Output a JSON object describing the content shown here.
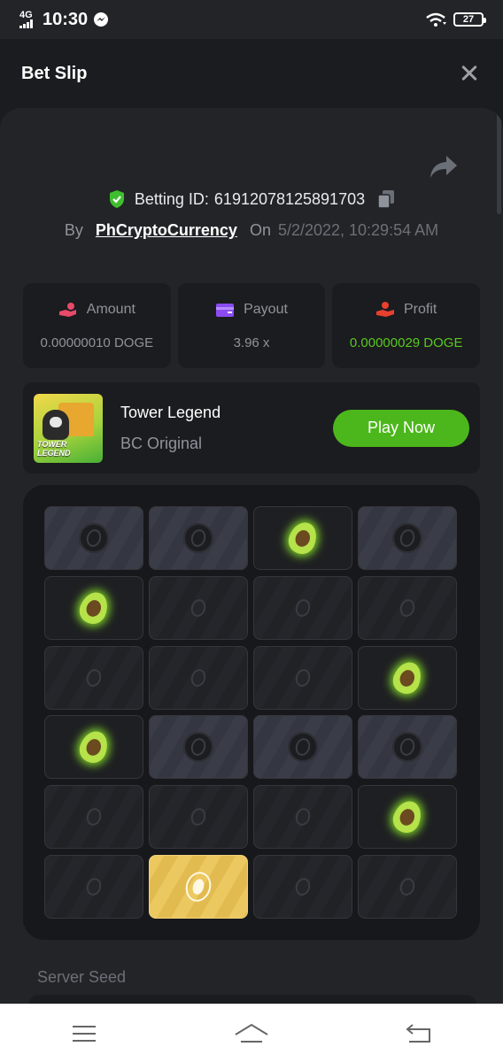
{
  "status_bar": {
    "network": "4G",
    "time": "10:30",
    "battery": "27"
  },
  "header": {
    "title": "Bet Slip"
  },
  "bet": {
    "betting_id_label": "Betting ID:",
    "betting_id": "61912078125891703",
    "by_label": "By",
    "username": "PhCryptoCurrency",
    "on_label": "On",
    "datetime": "5/2/2022, 10:29:54 AM"
  },
  "stats": {
    "amount": {
      "label": "Amount",
      "value": "0.00000010 DOGE"
    },
    "payout": {
      "label": "Payout",
      "value": "3.96 x"
    },
    "profit": {
      "label": "Profit",
      "value": "0.00000029 DOGE"
    }
  },
  "game": {
    "thumb_text_1": "TOWER",
    "thumb_text_2": "LEGEND",
    "name": "Tower Legend",
    "provider": "BC Original",
    "play_label": "Play Now"
  },
  "board": {
    "rows": [
      [
        "hidden",
        "hidden",
        "gem",
        "hidden"
      ],
      [
        "gem",
        "dim",
        "dim",
        "dim"
      ],
      [
        "dim",
        "dim",
        "dim",
        "gem"
      ],
      [
        "gem",
        "hidden",
        "hidden",
        "hidden"
      ],
      [
        "dim",
        "dim",
        "dim",
        "gem"
      ],
      [
        "dim",
        "picked",
        "dim",
        "dim"
      ]
    ]
  },
  "server_seed": {
    "label": "Server Seed"
  },
  "colors": {
    "accent_green": "#4cb71c",
    "profit_green": "#58c91f",
    "panel": "#232427",
    "background": "#1b1c1f"
  },
  "icons": {
    "share": "share-arrow-icon",
    "verified": "shield-check-icon",
    "copy": "copy-icon",
    "amount": "money-hand-icon",
    "payout": "wallet-icon",
    "profit": "profit-hand-icon",
    "close": "close-icon"
  }
}
